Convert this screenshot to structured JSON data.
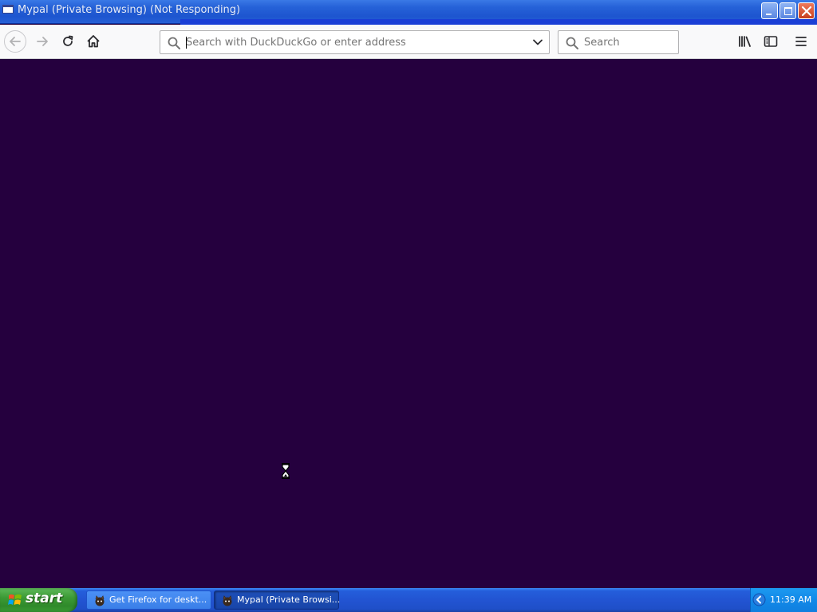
{
  "window": {
    "title": "Mypal (Private Browsing) (Not Responding)",
    "state": "not-responding"
  },
  "toolbar": {
    "back_icon": "back-arrow-icon",
    "forward_icon": "forward-arrow-icon",
    "reload_icon": "reload-icon",
    "home_icon": "home-icon",
    "library_icon": "library-icon",
    "sidebar_icon": "sidebar-icon",
    "menu_icon": "hamburger-menu-icon"
  },
  "urlbar": {
    "placeholder": "Search with DuckDuckGo or enter address",
    "value": ""
  },
  "searchbar": {
    "placeholder": "Search",
    "value": ""
  },
  "content": {
    "background": "#25003e",
    "cursor": "hourglass-icon"
  },
  "taskbar": {
    "start_label": "start",
    "tasks": [
      {
        "label": "Get Firefox for deskt...",
        "active": false
      },
      {
        "label": "Mypal (Private Browsi...",
        "active": true
      }
    ],
    "clock": "11:39 AM"
  },
  "colors": {
    "titlebar": "#2662d8",
    "taskbar": "#245edb",
    "start_button": "#3c9a35",
    "tray": "#1289e8"
  }
}
